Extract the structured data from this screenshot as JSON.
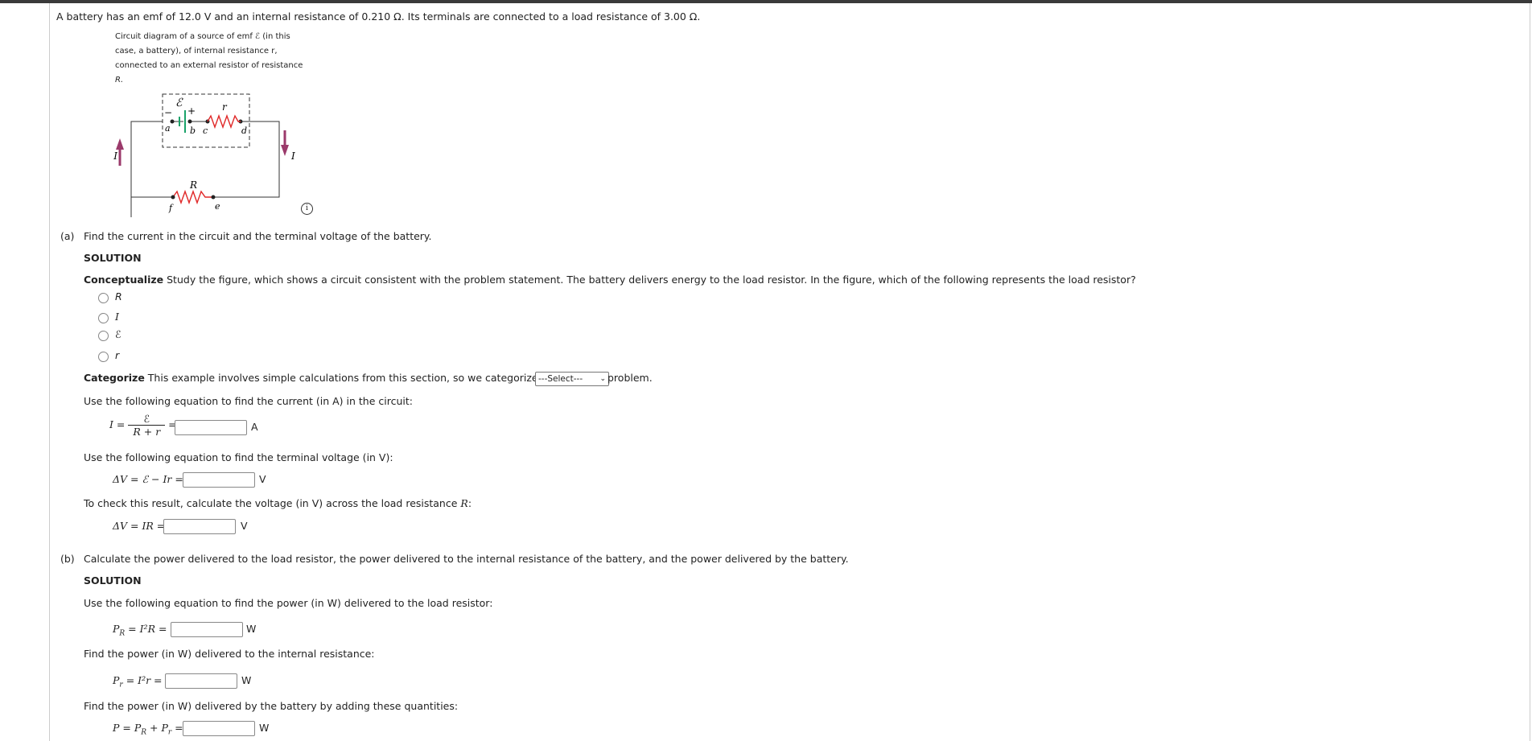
{
  "problem": "A battery has an emf of 12.0 V and an internal resistance of 0.210 Ω. Its terminals are connected to a load resistance of 3.00 Ω.",
  "figure": {
    "caption_lines": [
      "Circuit diagram of a source of emf ℰ (in this",
      "case, a battery), of internal resistance r,",
      "connected to an external resistor of resistance",
      "R."
    ],
    "labels": {
      "emf": "ℰ",
      "minus": "−",
      "plus": "+",
      "r": "r",
      "a": "a",
      "b": "b",
      "c": "c",
      "d": "d",
      "I_left": "I",
      "I_right": "I",
      "R": "R",
      "f": "f",
      "e": "e"
    },
    "colors": {
      "battery": "#1aa36a",
      "resistor": "#e02828",
      "arrow": "#9b3a6b"
    },
    "info_icon": "i"
  },
  "part_a": {
    "label": "(a)",
    "question": "Find the current in the circuit and the terminal voltage of the battery.",
    "solution": "SOLUTION",
    "conceptualize_head": "Conceptualize",
    "conceptualize_text": "Study the figure, which shows a circuit consistent with the problem statement. The battery delivers energy to the load resistor. In the figure, which of the following represents the load resistor?",
    "options": [
      "R",
      "I",
      "ℰ",
      "r"
    ],
    "categorize_head": "Categorize",
    "categorize_text": "This example involves simple calculations from this section, so we categorize it as",
    "select_value": "---Select---",
    "categorize_tail": "problem.",
    "current_prompt": "Use the following equation to find the current (in A) in the circuit:",
    "current_eq": {
      "lhs": "I =",
      "num": "ℰ",
      "den": "R + r",
      "eq": "=",
      "unit": "A",
      "value": ""
    },
    "terminal_prompt": "Use the following equation to find the terminal voltage (in V):",
    "terminal_eq": {
      "lhs": "ΔV = ℰ − Ir =",
      "unit": "V",
      "value": ""
    },
    "check_prompt_pre": "To check this result, calculate the voltage (in V) across the load resistance ",
    "check_prompt_var": "R",
    "check_prompt_post": ":",
    "check_eq": {
      "lhs": "ΔV = IR =",
      "unit": "V",
      "value": ""
    }
  },
  "part_b": {
    "label": "(b)",
    "question": "Calculate the power delivered to the load resistor, the power delivered to the internal resistance of the battery, and the power delivered by the battery.",
    "solution": "SOLUTION",
    "load_prompt": "Use the following equation to find the power (in W) delivered to the load resistor:",
    "load_eq": {
      "lhs": "P",
      "sub": "R",
      "rhs": " = I²R =",
      "unit": "W",
      "value": ""
    },
    "internal_prompt": "Find the power (in W) delivered to the internal resistance:",
    "internal_eq": {
      "lhs": "P",
      "sub": "r",
      "rhs": " = I²r =",
      "unit": "W",
      "value": ""
    },
    "battery_prompt": "Find the power (in W) delivered by the battery by adding these quantities:",
    "battery_eq": {
      "lhs": "P = P",
      "sub1": "R",
      "mid": " + P",
      "sub2": "r",
      "rhs": " =",
      "unit": "W",
      "value": ""
    }
  }
}
